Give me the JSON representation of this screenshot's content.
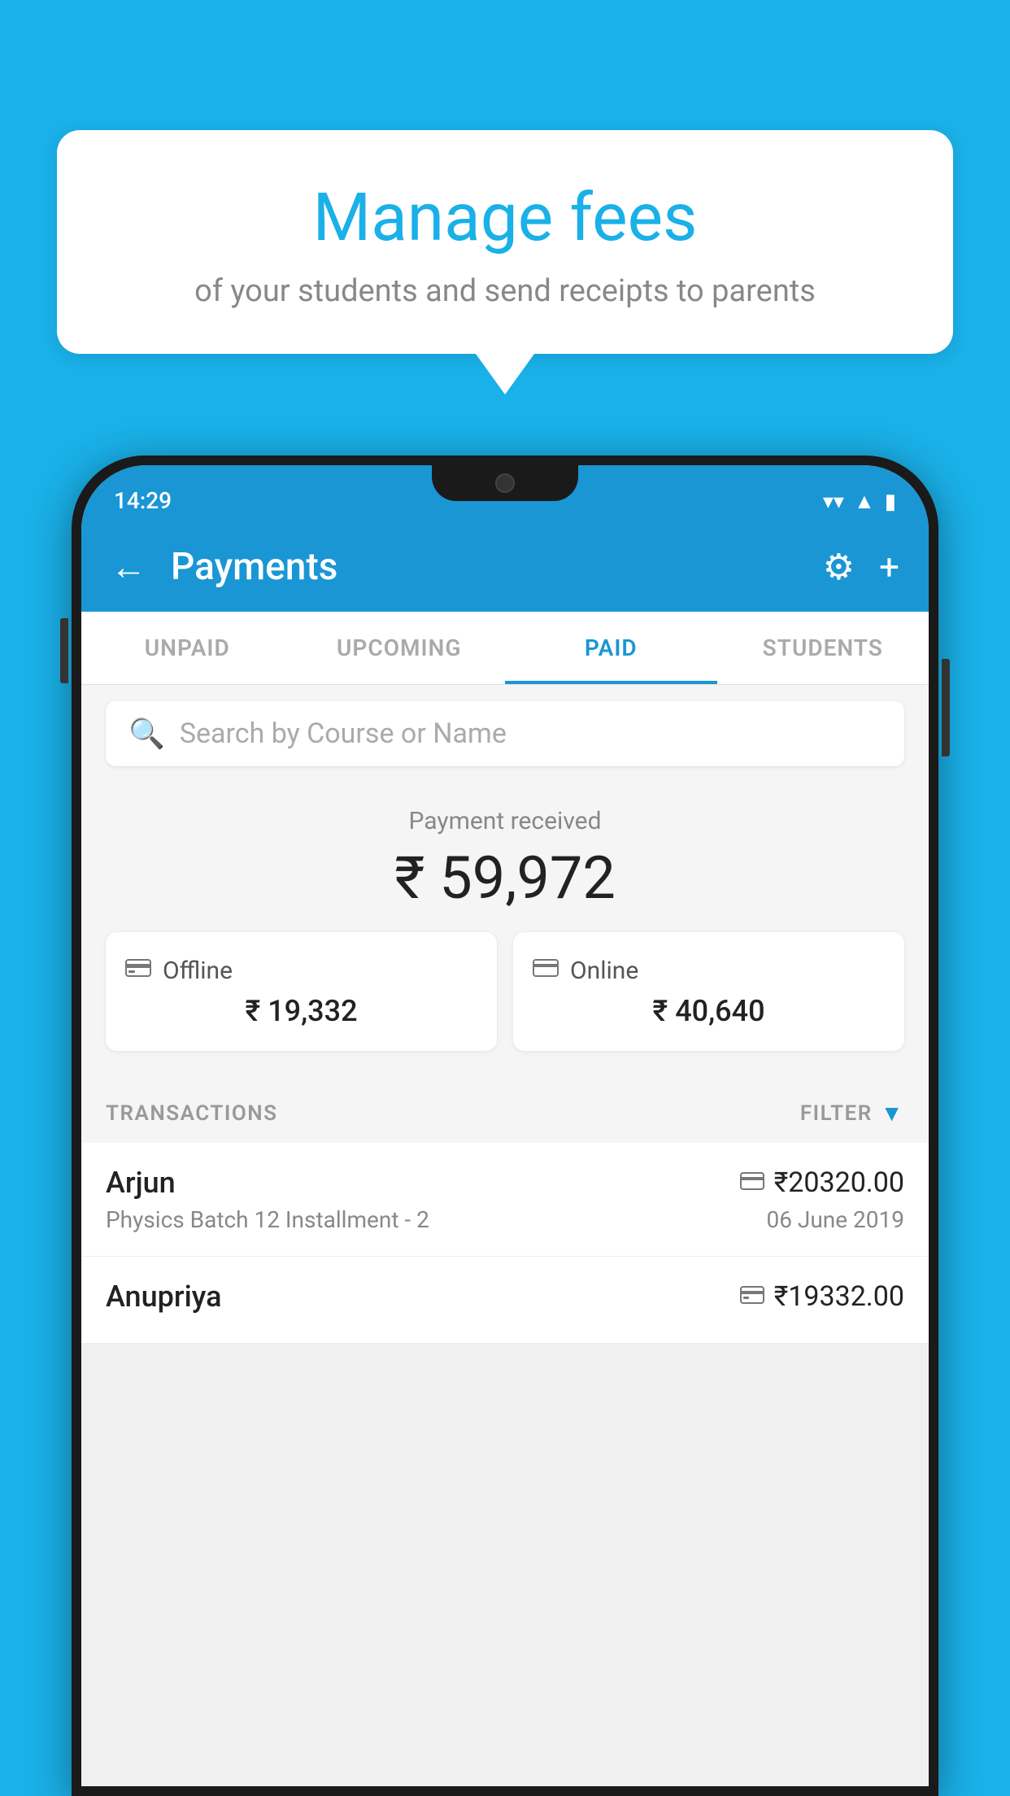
{
  "page": {
    "background_color": "#1ab0e8"
  },
  "bubble": {
    "title": "Manage fees",
    "subtitle": "of your students and send receipts to parents"
  },
  "status_bar": {
    "time": "14:29",
    "wifi_icon": "▼",
    "signal_icon": "▲",
    "battery_icon": "▮"
  },
  "app_bar": {
    "title": "Payments",
    "back_label": "←",
    "gear_label": "⚙",
    "plus_label": "+"
  },
  "tabs": [
    {
      "id": "unpaid",
      "label": "UNPAID",
      "active": false
    },
    {
      "id": "upcoming",
      "label": "UPCOMING",
      "active": false
    },
    {
      "id": "paid",
      "label": "PAID",
      "active": true
    },
    {
      "id": "students",
      "label": "STUDENTS",
      "active": false
    }
  ],
  "search": {
    "placeholder": "Search by Course or Name"
  },
  "payment_summary": {
    "label": "Payment received",
    "total_amount": "₹ 59,972",
    "offline": {
      "icon": "💳",
      "label": "Offline",
      "amount": "₹ 19,332"
    },
    "online": {
      "icon": "💳",
      "label": "Online",
      "amount": "₹ 40,640"
    }
  },
  "transactions": {
    "label": "TRANSACTIONS",
    "filter_label": "FILTER",
    "items": [
      {
        "name": "Arjun",
        "course": "Physics Batch 12 Installment - 2",
        "amount": "₹20320.00",
        "date": "06 June 2019",
        "payment_type": "online"
      },
      {
        "name": "Anupriya",
        "course": "",
        "amount": "₹19332.00",
        "date": "",
        "payment_type": "offline"
      }
    ]
  }
}
